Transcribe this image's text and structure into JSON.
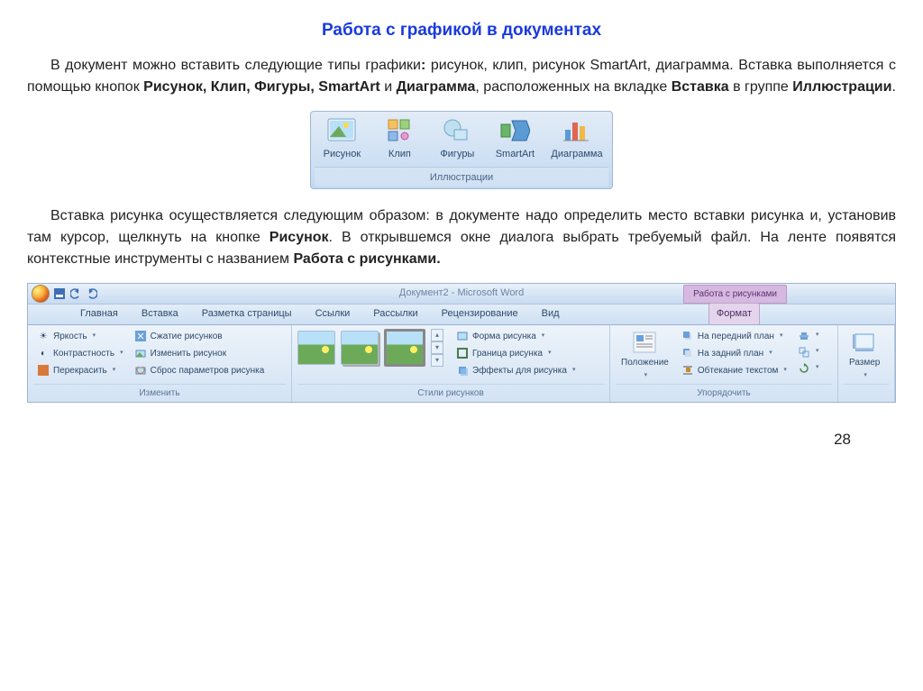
{
  "title": "Работа с графикой в документах",
  "para1_html": "В документ можно вставить следующие типы графики<b>:</b> рисунок, клип, рисунок SmartArt, диаграмма. Вставка выполняется с помощью кнопок <b>Рисунок, Клип, Фигуры, SmartArt</b> и <b>Диаграмма</b>, расположенных на вкладке <b>Вставка</b> в группе <b>Иллюстрации</b>.",
  "illus_group": {
    "items": [
      "Рисунок",
      "Клип",
      "Фигуры",
      "SmartArt",
      "Диаграмма"
    ],
    "footer": "Иллюстрации"
  },
  "para2_html": "Вставка рисунка осуществляется следующим образом: в документе надо определить место вставки рисунка и, установив там курсор, щелкнуть на кнопке <b>Рисунок</b>. В открывшемся окне диалога выбрать требуемый файл. На ленте появятся контекстные инструменты с названием <b>Работа с рисунками.</b>",
  "word": {
    "doc_title": "Документ2 - Microsoft Word",
    "ctx_title": "Работа с рисунками",
    "tabs": [
      "Главная",
      "Вставка",
      "Разметка страницы",
      "Ссылки",
      "Рассылки",
      "Рецензирование",
      "Вид"
    ],
    "ctx_tab": "Формат",
    "groups": {
      "adjust": {
        "label": "Изменить",
        "items": {
          "brightness": "Яркость",
          "contrast": "Контрастность",
          "recolor": "Перекрасить",
          "compress": "Сжатие рисунков",
          "change": "Изменить рисунок",
          "reset": "Сброс параметров рисунка"
        }
      },
      "styles": {
        "label": "Стили рисунков",
        "shape": "Форма рисунка",
        "border": "Граница рисунка",
        "effects": "Эффекты для рисунка"
      },
      "arrange": {
        "label": "Упорядочить",
        "position": "Положение",
        "front": "На передний план",
        "back": "На задний план",
        "wrap": "Обтекание текстом"
      },
      "size": {
        "label": "Размер"
      }
    }
  },
  "page_number": "28"
}
